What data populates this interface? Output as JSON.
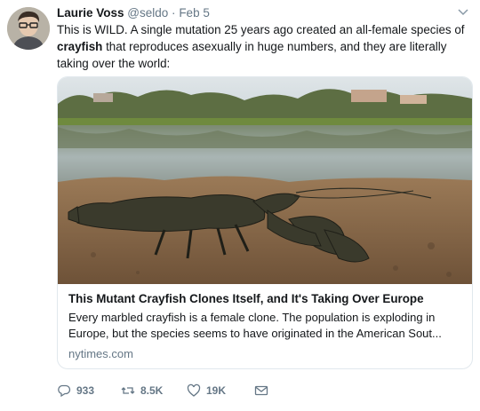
{
  "tweet": {
    "author_name": "Laurie Voss",
    "author_handle": "@seldo",
    "separator": "·",
    "date": "Feb 5",
    "text_part1": "This is WILD. A single mutation 25 years ago created an all-female species of ",
    "text_bold": "crayfish",
    "text_part2": " that reproduces asexually in huge numbers, and they are literally taking over the world:"
  },
  "card": {
    "title": "This Mutant Crayfish Clones Itself, and It's Taking Over Europe",
    "description": "Every marbled crayfish is a female clone. The population is exploding in Europe, but the species seems to have originated in the American Sout...",
    "domain": "nytimes.com"
  },
  "actions": {
    "replies": "933",
    "retweets": "8.5K",
    "likes": "19K"
  },
  "icons": [
    "reply-icon",
    "retweet-icon",
    "like-icon",
    "message-icon",
    "chevron-down-icon"
  ],
  "colors": {
    "text": "#14171a",
    "muted": "#657786",
    "border": "#e1e8ed"
  }
}
